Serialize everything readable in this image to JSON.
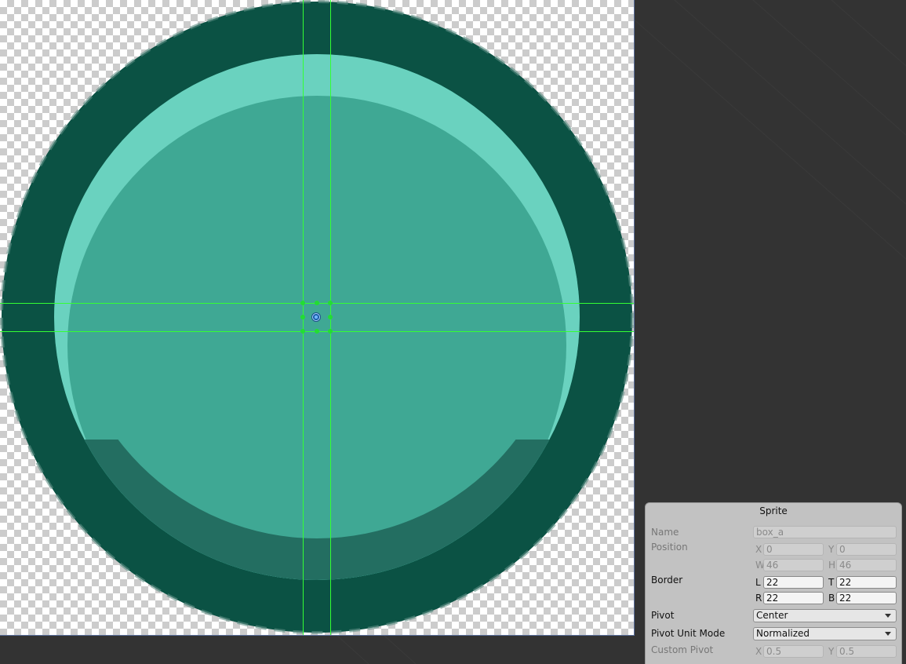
{
  "sprite_panel": {
    "title": "Sprite",
    "name": {
      "label": "Name",
      "value": "box_a"
    },
    "position": {
      "label": "Position",
      "x_label": "X",
      "x": "0",
      "y_label": "Y",
      "y": "0",
      "w_label": "W",
      "w": "46",
      "h_label": "H",
      "h": "46"
    },
    "border": {
      "label": "Border",
      "l_label": "L",
      "l": "22",
      "t_label": "T",
      "t": "22",
      "r_label": "R",
      "r": "22",
      "b_label": "B",
      "b": "22"
    },
    "pivot": {
      "label": "Pivot",
      "value": "Center"
    },
    "pivot_unit_mode": {
      "label": "Pivot Unit Mode",
      "value": "Normalized"
    },
    "custom_pivot": {
      "label": "Custom Pivot",
      "x_label": "X",
      "x": "0.5",
      "y_label": "Y",
      "y": "0.5"
    }
  },
  "colors": {
    "outer_ring": "#0b5244",
    "highlight": "#6ad2bf",
    "body": "#3fa894",
    "shadow": "#236e61",
    "guide": "#33ff33",
    "pivot_handle": "#1c5fa8"
  },
  "icons": [
    "pivot-handle-icon",
    "dropdown-arrow-icon"
  ]
}
